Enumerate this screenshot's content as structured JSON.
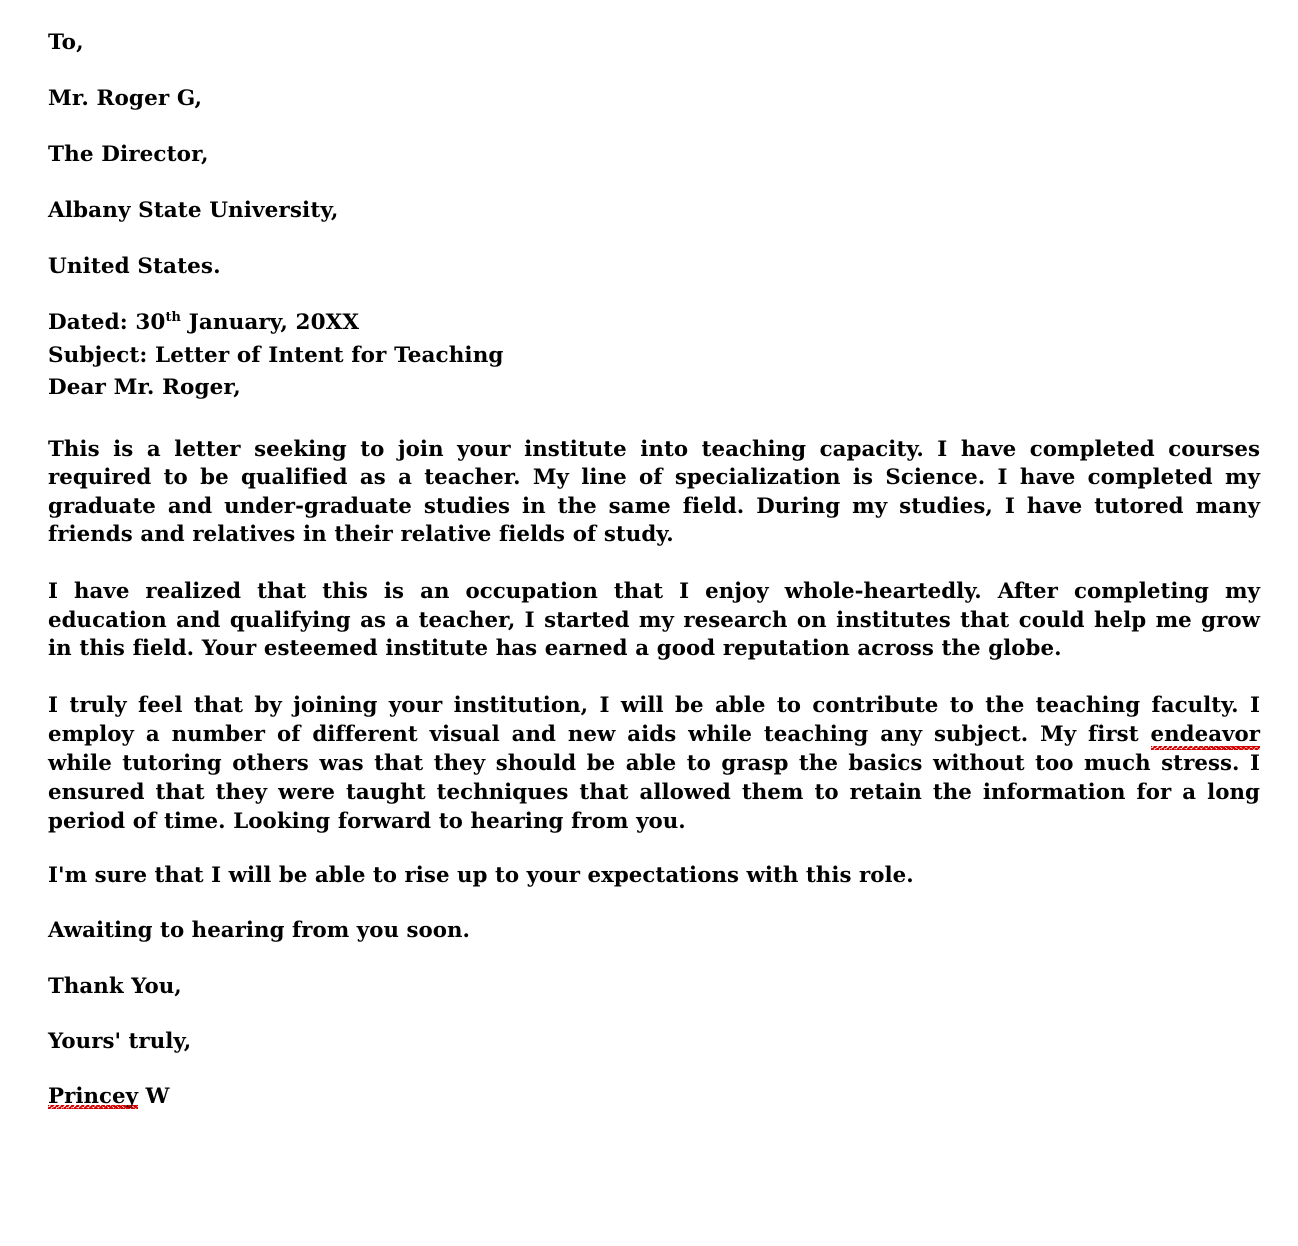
{
  "document": {
    "type": "letter",
    "background_color": "#ffffff",
    "text_color": "#000000",
    "spellcheck_underline_color": "#d40000",
    "recipient_block": [
      "To,",
      "Mr. Roger G,",
      "The Director,",
      "Albany State University,",
      "United States."
    ],
    "meta": {
      "dated_label": "Dated: 30",
      "dated_ordinal": "th",
      "dated_rest": " January, 20XX",
      "subject": "Subject:  Letter of Intent for Teaching",
      "salutation": "Dear Mr. Roger,"
    },
    "paragraphs": [
      "This is a letter seeking to join your institute into teaching capacity. I have completed courses required to be qualified as a teacher. My line of specialization is Science. I have completed my graduate and under-graduate studies in the same field. During my studies, I have tutored many friends and relatives in their relative fields of study.",
      "I have realized that this is an occupation that I enjoy whole-heartedly. After completing my education and qualifying as a teacher, I started my research on institutes that could help me grow in this field. Your esteemed institute has earned a good reputation across the globe."
    ],
    "paragraph_three": {
      "before": "I truly feel that by joining your institution, I will be able to contribute to the teaching faculty. I employ a number of different visual and new aids while teaching any subject. My first ",
      "misspelled": "endeavor",
      "after": " while tutoring others was that they should be able to grasp the basics without too much stress. I ensured that they were taught techniques that allowed them to retain the information for a long period of time. Looking forward to hearing from you."
    },
    "closing": [
      "I'm sure that I will be able to rise up to your expectations with this role.",
      "Awaiting to hearing from you soon.",
      "Thank You,",
      "Yours' truly,"
    ],
    "signature": {
      "misspelled_name": "Princey",
      "name_rest": " W"
    }
  }
}
